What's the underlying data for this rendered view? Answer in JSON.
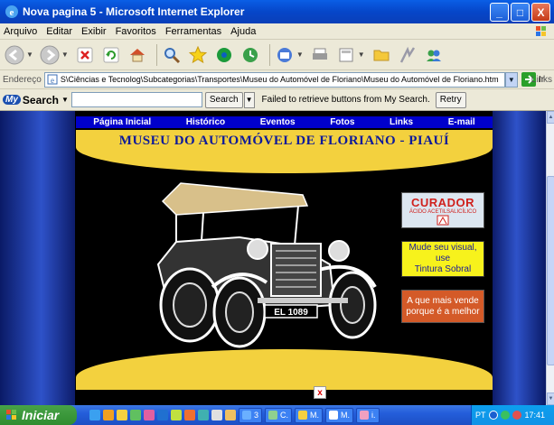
{
  "window": {
    "title": "Nova pagina 5 - Microsoft Internet Explorer",
    "minimize": "_",
    "maximize": "□",
    "close": "X"
  },
  "menu": {
    "items": [
      "Arquivo",
      "Editar",
      "Exibir",
      "Favoritos",
      "Ferramentas",
      "Ajuda"
    ]
  },
  "toolbar": {
    "icons": [
      "back-icon",
      "forward-icon",
      "stop-icon",
      "refresh-icon",
      "home-icon",
      "search-icon",
      "favorites-icon",
      "media-icon",
      "history-icon",
      "mail-icon",
      "print-icon",
      "edit-icon",
      "folder-icon",
      "messenger-icon",
      "msn-icon"
    ]
  },
  "address": {
    "label": "Endereço",
    "value": "S\\Ciências e Tecnolog\\Subcategorias\\Transportes\\Museu do Automóvel de Floriano\\Museu do Automóvel de Floriano.htm",
    "go_label": "Ir",
    "links_label": "Links"
  },
  "search": {
    "brand_my": "My",
    "brand_search": "Search",
    "input_value": "",
    "button_label": "Search",
    "message": "Failed to retrieve buttons from My Search.",
    "retry_label": "Retry"
  },
  "page": {
    "nav": [
      "Página Inicial",
      "Histórico",
      "Eventos",
      "Fotos",
      "Links",
      "E-mail"
    ],
    "title": "MUSEU DO AUTOMÓVEL DE FLORIANO - PIAUÍ",
    "plate": "EL 1089",
    "ads": {
      "curador_brand": "CURADOR",
      "curador_sub": "ÁCIDO ACETILSALICÍLICO",
      "tintura_line1": "Mude seu visual, use",
      "tintura_line2": "Tintura Sobral",
      "orange_line1": "A que mais vende",
      "orange_line2": "porque é a melhor"
    },
    "broken_image": "x"
  },
  "taskbar": {
    "start_label": "Iniciar",
    "tasks": [
      "3",
      "C.",
      "M.",
      "M.",
      "i."
    ],
    "language": "PT",
    "clock": "17:41"
  },
  "colors": {
    "nav_bg": "#0000cc",
    "banner_yellow": "#f3d13e",
    "title_blue": "#0d1a9a",
    "side_blue": "#2e52c9"
  }
}
